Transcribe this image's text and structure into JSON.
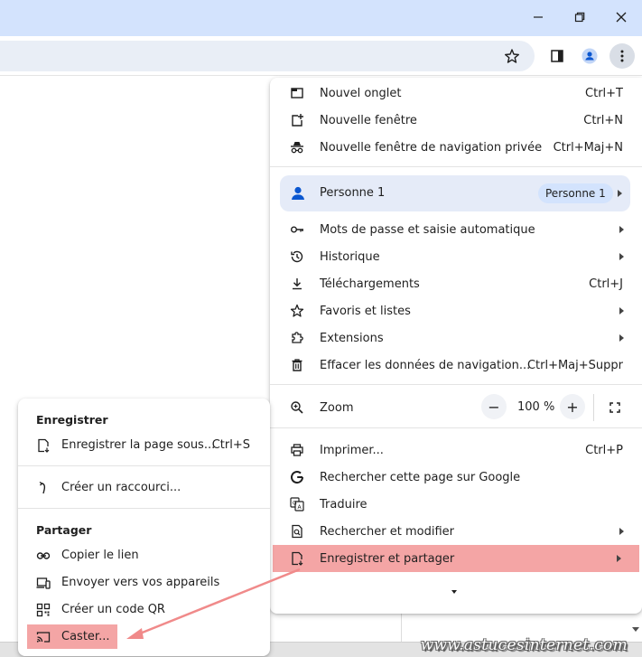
{
  "window": {
    "minimize_icon": "minimize-icon",
    "restore_icon": "restore-icon",
    "close_icon": "close-icon"
  },
  "toolbar": {
    "bookmark_icon": "star-icon",
    "side_panel_icon": "side-panel-icon",
    "profile_icon": "profile-icon",
    "menu_icon": "vertical-dots-icon"
  },
  "menu": {
    "new_tab": {
      "label": "Nouvel onglet",
      "shortcut": "Ctrl+T"
    },
    "new_window": {
      "label": "Nouvelle fenêtre",
      "shortcut": "Ctrl+N"
    },
    "incognito": {
      "label": "Nouvelle fenêtre de navigation privée",
      "shortcut": "Ctrl+Maj+N"
    },
    "profile": {
      "label": "Personne 1",
      "pill": "Personne 1"
    },
    "passwords": {
      "label": "Mots de passe et saisie automatique"
    },
    "history": {
      "label": "Historique"
    },
    "downloads": {
      "label": "Téléchargements",
      "shortcut": "Ctrl+J"
    },
    "bookmarks": {
      "label": "Favoris et listes"
    },
    "extensions": {
      "label": "Extensions"
    },
    "clear_data": {
      "label": "Effacer les données de navigation...",
      "shortcut": "Ctrl+Maj+Suppr"
    },
    "zoom": {
      "label": "Zoom",
      "minus": "−",
      "value": "100 %",
      "plus": "+"
    },
    "print": {
      "label": "Imprimer...",
      "shortcut": "Ctrl+P"
    },
    "search_google": {
      "label": "Rechercher cette page sur Google"
    },
    "translate": {
      "label": "Traduire"
    },
    "find_edit": {
      "label": "Rechercher et modifier"
    },
    "save_share": {
      "label": "Enregistrer et partager"
    }
  },
  "submenu": {
    "save_header": "Enregistrer",
    "save_page": {
      "label": "Enregistrer la page sous...",
      "shortcut": "Ctrl+S"
    },
    "shortcut": {
      "label": "Créer un raccourci..."
    },
    "share_header": "Partager",
    "copy_link": {
      "label": "Copier le lien"
    },
    "send_devices": {
      "label": "Envoyer vers vos appareils"
    },
    "qr_code": {
      "label": "Créer un code QR"
    },
    "cast": {
      "label": "Caster..."
    }
  },
  "watermark": "www.astucesinternet.com",
  "colors": {
    "titlebar": "#d3e3fd",
    "highlight": "#f4a5a5",
    "annotation_arrow": "#f08a8a",
    "profile_row": "#e5ebf8",
    "accent_blue": "#0b57d0"
  }
}
